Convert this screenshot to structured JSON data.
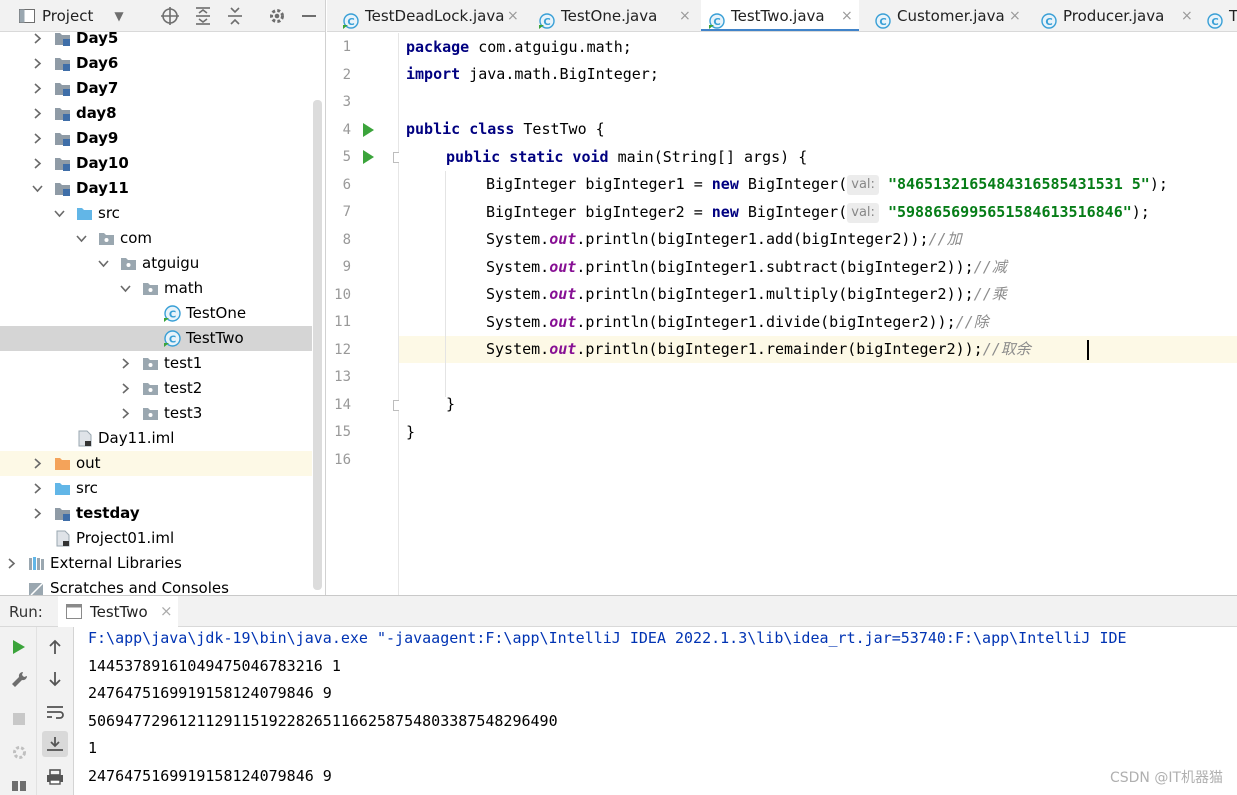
{
  "project": {
    "title": "Project",
    "tree": [
      {
        "label": "Day5",
        "type": "module-folder",
        "level": 1,
        "arrow": "›",
        "bold": true
      },
      {
        "label": "Day6",
        "type": "module-folder",
        "level": 1,
        "arrow": "›",
        "bold": true
      },
      {
        "label": "Day7",
        "type": "module-folder",
        "level": 1,
        "arrow": "›",
        "bold": true
      },
      {
        "label": "day8",
        "type": "module-folder",
        "level": 1,
        "arrow": "›",
        "bold": true
      },
      {
        "label": "Day9",
        "type": "module-folder",
        "level": 1,
        "arrow": "›",
        "bold": true
      },
      {
        "label": "Day10",
        "type": "module-folder",
        "level": 1,
        "arrow": "›",
        "bold": true
      },
      {
        "label": "Day11",
        "type": "module-folder",
        "level": 1,
        "arrow": "⌄",
        "bold": true
      },
      {
        "label": "src",
        "type": "source-folder",
        "level": 2,
        "arrow": "⌄",
        "bold": false
      },
      {
        "label": "com",
        "type": "package",
        "level": 3,
        "arrow": "⌄",
        "bold": false
      },
      {
        "label": "atguigu",
        "type": "package",
        "level": 4,
        "arrow": "⌄",
        "bold": false
      },
      {
        "label": "math",
        "type": "package",
        "level": 5,
        "arrow": "⌄",
        "bold": false
      },
      {
        "label": "TestOne",
        "type": "class",
        "level": 6,
        "arrow": "",
        "bold": false
      },
      {
        "label": "TestTwo",
        "type": "class",
        "level": 6,
        "arrow": "",
        "bold": false,
        "selected": true
      },
      {
        "label": "test1",
        "type": "package",
        "level": 5,
        "arrow": "›",
        "bold": false
      },
      {
        "label": "test2",
        "type": "package",
        "level": 5,
        "arrow": "›",
        "bold": false
      },
      {
        "label": "test3",
        "type": "package",
        "level": 5,
        "arrow": "›",
        "bold": false
      },
      {
        "label": "Day11.iml",
        "type": "iml-file",
        "level": 2,
        "arrow": "",
        "bold": false
      },
      {
        "label": "out",
        "type": "excluded-folder",
        "level": 1,
        "arrow": "›",
        "bold": false,
        "highlight": true
      },
      {
        "label": "src",
        "type": "source-folder",
        "level": 1,
        "arrow": "›",
        "bold": false
      },
      {
        "label": "testday",
        "type": "module-folder",
        "level": 1,
        "arrow": "›",
        "bold": true
      },
      {
        "label": "Project01.iml",
        "type": "iml-file",
        "level": 1,
        "arrow": "",
        "bold": false
      },
      {
        "label": "External Libraries",
        "type": "libraries",
        "level": 0,
        "arrow": "›",
        "bold": false
      },
      {
        "label": "Scratches and Consoles",
        "type": "scratches",
        "level": 0,
        "arrow": "",
        "bold": false
      }
    ]
  },
  "editor": {
    "tabs": [
      {
        "label": "TestDeadLock.java",
        "active": false
      },
      {
        "label": "TestOne.java",
        "active": false
      },
      {
        "label": "TestTwo.java",
        "active": true
      },
      {
        "label": "Customer.java",
        "active": false
      },
      {
        "label": "Producer.java",
        "active": false
      },
      {
        "label": "T",
        "active": false
      }
    ],
    "line_numbers": [
      "1",
      "2",
      "3",
      "4",
      "5",
      "6",
      "7",
      "8",
      "9",
      "10",
      "11",
      "12",
      "13",
      "14",
      "15",
      "16"
    ],
    "hint_label": "val:",
    "code": {
      "l1_kw": "package",
      "l1_rest": " com.atguigu.math;",
      "l2_kw": "import",
      "l2_rest": " java.math.BigInteger;",
      "l4_kw": "public class",
      "l4_rest": " TestTwo {",
      "l5_kw": "public static void",
      "l5_rest": " main(String[] args) {",
      "l6_a": "BigInteger bigInteger1 = ",
      "l6_kw": "new",
      "l6_b": " BigInteger(",
      "l6_str": "\"8465132165484316585431531 5\"",
      "l6_end": ");",
      "l7_a": "BigInteger bigInteger2 = ",
      "l7_kw": "new",
      "l7_b": " BigInteger(",
      "l7_str": "\"5988656995651584613516846\"",
      "l7_end": ");",
      "sys": "System.",
      "out": "out",
      "l8_rest": ".println(bigInteger1.add(bigInteger2));",
      "l8_cm": "//加",
      "l9_rest": ".println(bigInteger1.subtract(bigInteger2));",
      "l9_cm": "//减",
      "l10_rest": ".println(bigInteger1.multiply(bigInteger2));",
      "l10_cm": "//乘",
      "l11_rest": ".println(bigInteger1.divide(bigInteger2));",
      "l11_cm": "//除",
      "l12_rest": ".println(bigInteger1.remainder(bigInteger2));",
      "l12_cm": "//取余",
      "l14": "}",
      "l15": "}"
    }
  },
  "run": {
    "label": "Run:",
    "tab_label": "TestTwo",
    "close": "×",
    "console": [
      "F:\\app\\java\\jdk-19\\bin\\java.exe \"-javaagent:F:\\app\\IntelliJ IDEA 2022.1.3\\lib\\idea_rt.jar=53740:F:\\app\\IntelliJ IDE",
      "14453789161049475046783216 1",
      "2476475169919158124079846 9",
      "5069477296121129115192282651166258754803387548296490",
      "1",
      "2476475169919158124079846 9"
    ]
  },
  "watermark": "CSDN @IT机器猫",
  "colors": {
    "accent": "#4083c9",
    "run_green": "#3ba43b",
    "current_line": "#fdf9e6",
    "selection": "#d5d5d5"
  }
}
